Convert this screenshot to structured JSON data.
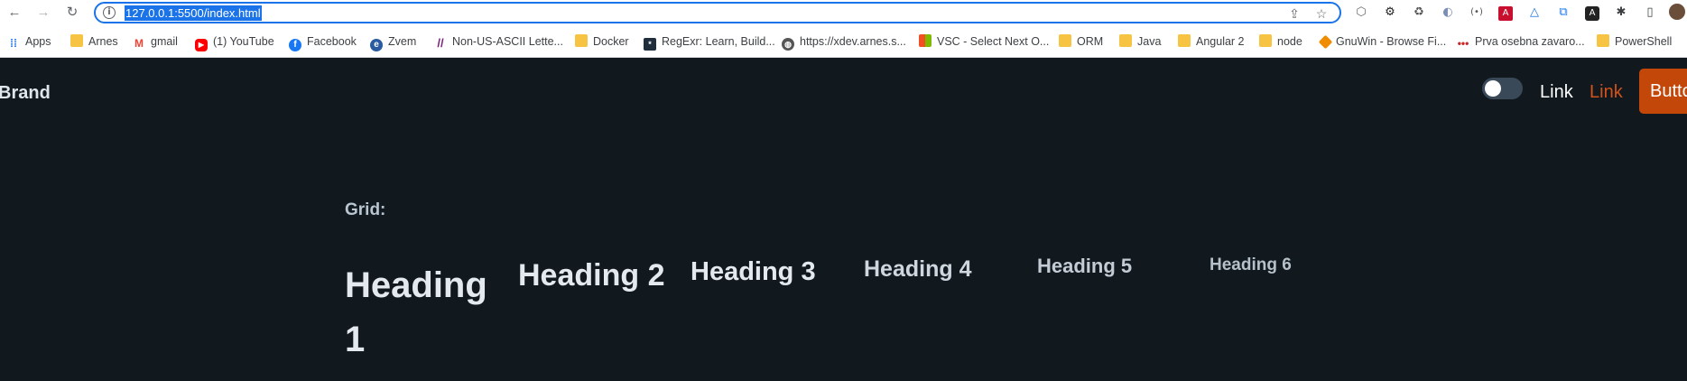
{
  "browser": {
    "url": "127.0.0.1:5500/index.html",
    "nav": {
      "back_icon": "←",
      "forward_icon": "→",
      "reload_icon": "↻"
    }
  },
  "bookmarks": [
    {
      "label": "Apps",
      "icon": "apps-grid-icon"
    },
    {
      "label": "Arnes",
      "icon": "folder-icon"
    },
    {
      "label": "gmail",
      "icon": "gmail-icon"
    },
    {
      "label": "(1) YouTube",
      "icon": "youtube-icon"
    },
    {
      "label": "Facebook",
      "icon": "facebook-icon"
    },
    {
      "label": "Zvem",
      "icon": "zvem-icon"
    },
    {
      "label": "Non-US-ASCII Lette...",
      "icon": "slashes-icon"
    },
    {
      "label": "Docker",
      "icon": "folder-icon"
    },
    {
      "label": "RegExr: Learn, Build...",
      "icon": "regexr-icon"
    },
    {
      "label": "https://xdev.arnes.s...",
      "icon": "globe-icon"
    },
    {
      "label": "VSC - Select Next O...",
      "icon": "microsoft-icon"
    },
    {
      "label": "ORM",
      "icon": "folder-icon"
    },
    {
      "label": "Java",
      "icon": "folder-icon"
    },
    {
      "label": "Angular 2",
      "icon": "folder-icon"
    },
    {
      "label": "node",
      "icon": "folder-icon"
    },
    {
      "label": "GnuWin - Browse Fi...",
      "icon": "gnuwin-icon"
    },
    {
      "label": "Prva osebna zavaro...",
      "icon": "dots-icon"
    },
    {
      "label": "PowerShell",
      "icon": "folder-icon"
    }
  ],
  "page": {
    "brand": "Brand",
    "nav_link_1": "Link",
    "nav_link_2": "Link",
    "button": "Button",
    "grid_label": "Grid:",
    "headings": [
      "Heading 1",
      "Heading 2",
      "Heading 3",
      "Heading 4",
      "Heading 5",
      "Heading 6"
    ],
    "colors": {
      "background": "#11191f",
      "accent": "#d2521b",
      "button": "#c4470a"
    }
  }
}
